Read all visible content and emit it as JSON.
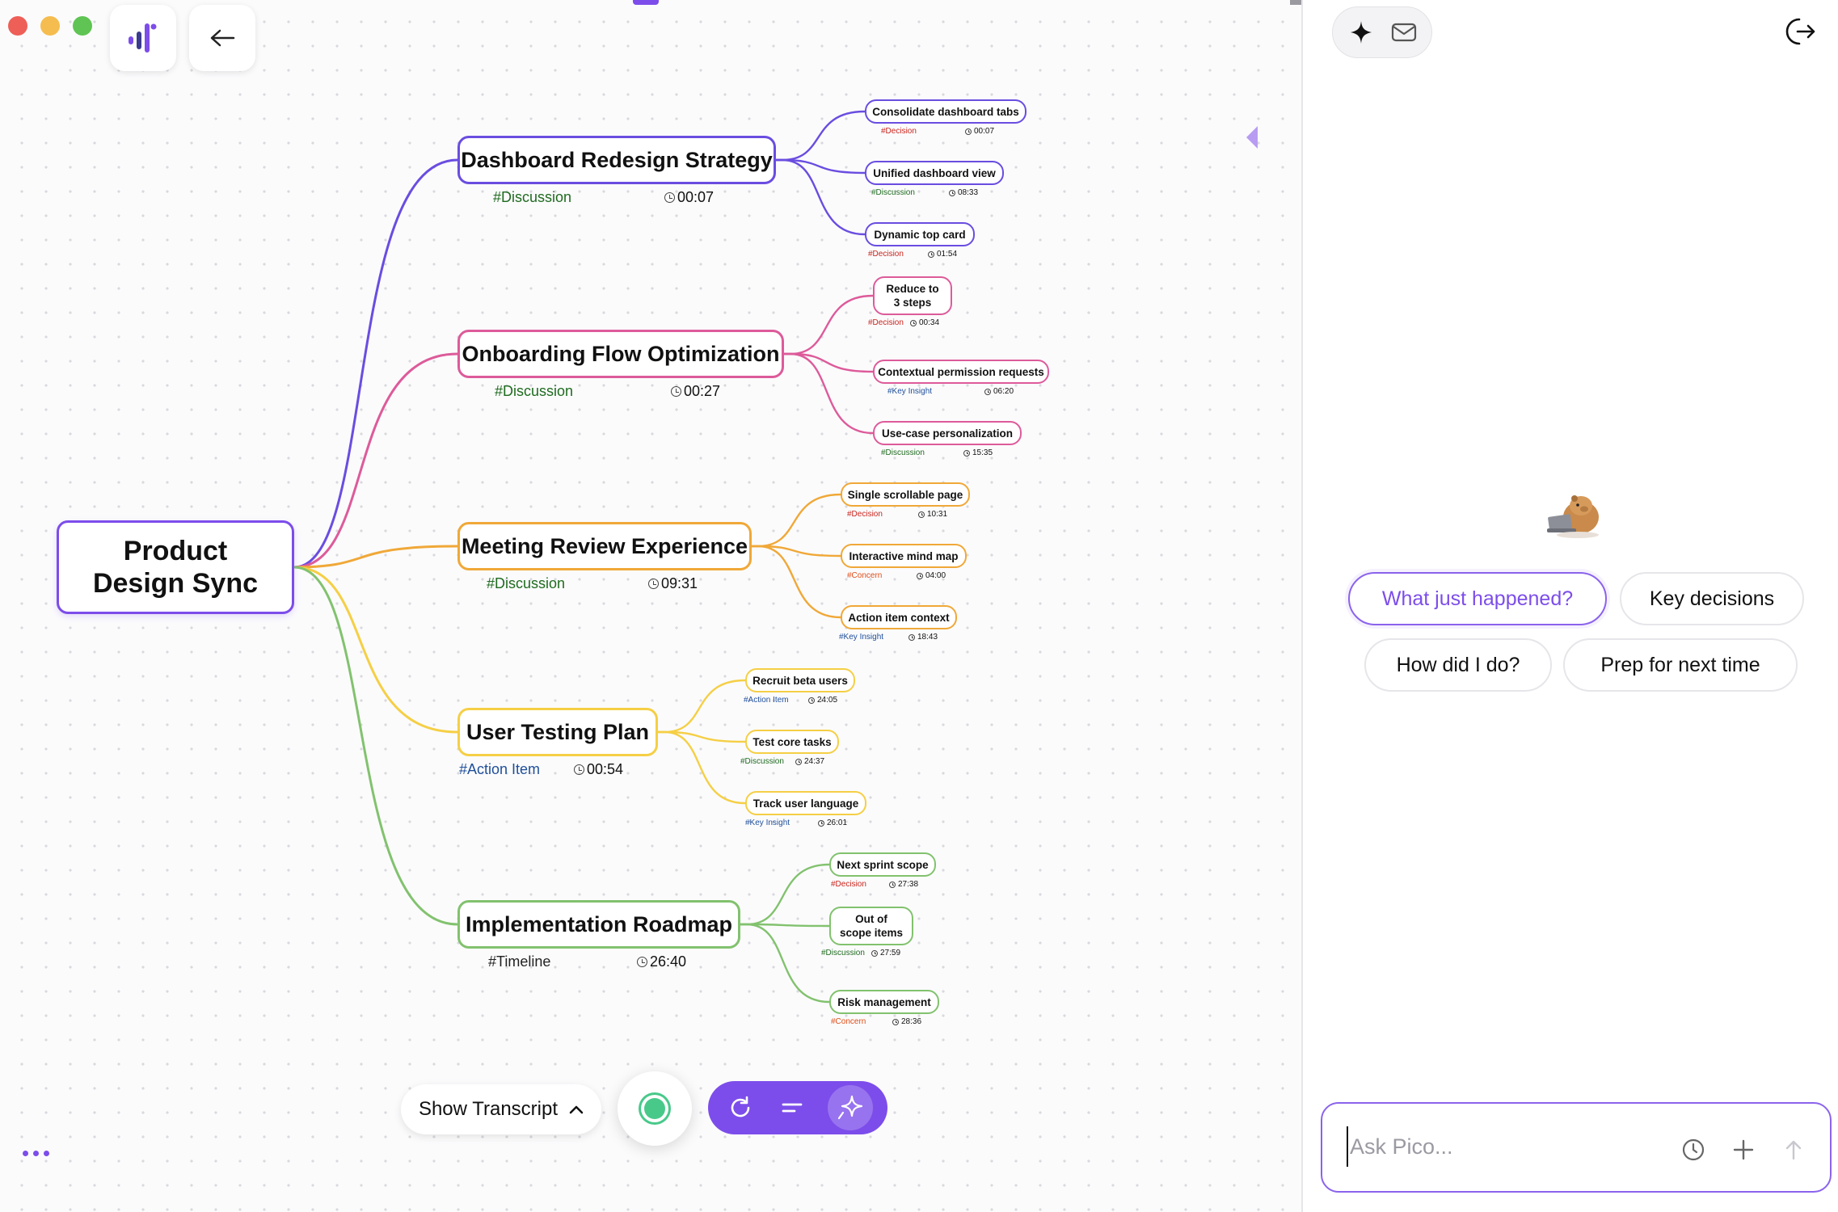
{
  "colors": {
    "accent": "#7c4dea",
    "branch_dashboard": "#6a4de0",
    "branch_onboarding": "#dd5b9a",
    "branch_meeting": "#f0a838",
    "branch_testing": "#f5cf45",
    "branch_roadmap": "#82c26e"
  },
  "toolbar_top": {
    "logo_icon": "waveform-logo-icon",
    "back_icon": "arrow-left-icon"
  },
  "mindmap": {
    "root": {
      "label": "Product Design Sync"
    },
    "branches": [
      {
        "label": "Dashboard Redesign Strategy",
        "tag": "#Discussion",
        "time": "00:07",
        "children": [
          {
            "label": "Consolidate dashboard tabs",
            "tag": "#Decision",
            "time": "00:07"
          },
          {
            "label": "Unified dashboard view",
            "tag": "#Discussion",
            "time": "08:33"
          },
          {
            "label": "Dynamic top card",
            "tag": "#Decision",
            "time": "01:54"
          }
        ]
      },
      {
        "label": "Onboarding Flow Optimization",
        "tag": "#Discussion",
        "time": "00:27",
        "children": [
          {
            "label": "Reduce to 3 steps",
            "tag": "#Decision",
            "time": "00:34"
          },
          {
            "label": "Contextual permission requests",
            "tag": "#Key Insight",
            "time": "06:20"
          },
          {
            "label": "Use-case personalization",
            "tag": "#Discussion",
            "time": "15:35"
          }
        ]
      },
      {
        "label": "Meeting Review Experience",
        "tag": "#Discussion",
        "time": "09:31",
        "children": [
          {
            "label": "Single scrollable page",
            "tag": "#Decision",
            "time": "10:31"
          },
          {
            "label": "Interactive mind map",
            "tag": "#Concern",
            "time": "04:00"
          },
          {
            "label": "Action item context",
            "tag": "#Key Insight",
            "time": "18:43"
          }
        ]
      },
      {
        "label": "User Testing Plan",
        "tag": "#Action Item",
        "time": "00:54",
        "children": [
          {
            "label": "Recruit beta users",
            "tag": "#Action Item",
            "time": "24:05"
          },
          {
            "label": "Test core tasks",
            "tag": "#Discussion",
            "time": "24:37"
          },
          {
            "label": "Track user language",
            "tag": "#Key Insight",
            "time": "26:01"
          }
        ]
      },
      {
        "label": "Implementation Roadmap",
        "tag": "#Timeline",
        "time": "26:40",
        "children": [
          {
            "label": "Next sprint scope",
            "tag": "#Decision",
            "time": "27:38"
          },
          {
            "label": "Out of scope items",
            "tag": "#Discussion",
            "time": "27:59"
          },
          {
            "label": "Risk management",
            "tag": "#Concern",
            "time": "28:36"
          }
        ]
      }
    ]
  },
  "tag_colors": {
    "#Discussion": "#1f6b1f",
    "#Decision": "#c8241c",
    "#Key Insight": "#1f4f9a",
    "#Concern": "#e04d16",
    "#Action Item": "#1f4f9a",
    "#Timeline": "#222222"
  },
  "bottom_toolbar": {
    "transcript_label": "Show Transcript",
    "transcript_icon": "chevron-up-icon",
    "record_icon": "record-dot-icon",
    "actions": [
      "refresh-icon",
      "lines-icon",
      "sparkle-icon"
    ]
  },
  "panel": {
    "tools": [
      "sparkle-icon",
      "mail-icon"
    ],
    "exit_icon": "exit-icon",
    "mascot_icon": "capybara-laptop-icon",
    "chips": [
      "What just happened?",
      "Key decisions",
      "How did I do?",
      "Prep for next time"
    ],
    "ask_placeholder": "Ask Pico...",
    "ask_icons": [
      "clock-icon",
      "plus-icon",
      "arrow-up-icon"
    ]
  }
}
